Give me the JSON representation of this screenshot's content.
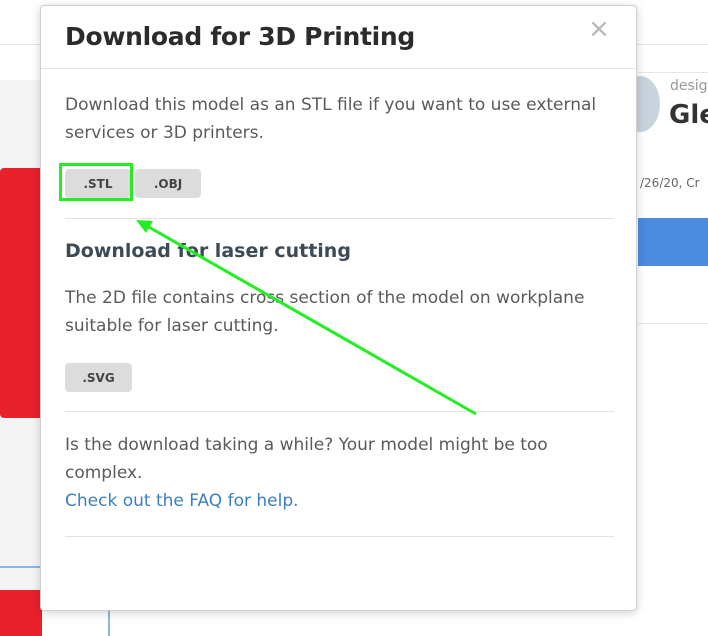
{
  "background": {
    "right_label": "design",
    "right_name": "Gle",
    "right_date": "/26/20, Cr"
  },
  "modal": {
    "title": "Download for 3D Printing",
    "close_symbol": "×",
    "stl_section": {
      "description": "Download this model as an STL file if you want to use external services or 3D printers.",
      "buttons": [
        ".STL",
        ".OBJ"
      ]
    },
    "laser_section": {
      "title": "Download for laser cutting",
      "description": "The 2D file contains cross section of the model on workplane suitable for laser cutting.",
      "buttons": [
        ".SVG"
      ]
    },
    "help": {
      "text": "Is the download taking a while? Your model might be too complex.",
      "link": "Check out the FAQ for help."
    }
  },
  "annotation": {
    "highlight_color": "#22ee22",
    "arrow_color": "#22ee22",
    "target": ".STL"
  },
  "colors": {
    "link": "#3a7fc0",
    "button_bg": "#dcdcdc",
    "accent_blue": "#4a8be0",
    "red_model": "#e8202a"
  }
}
